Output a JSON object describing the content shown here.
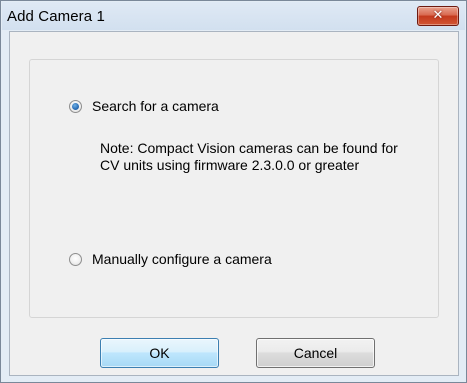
{
  "window": {
    "title": "Add Camera 1",
    "close_glyph": "✕"
  },
  "options": {
    "search": {
      "label": "Search for a camera",
      "selected": true
    },
    "note": "Note: Compact Vision cameras can be found for CV units using firmware 2.3.0.0 or greater",
    "manual": {
      "label": "Manually configure a camera",
      "selected": false
    }
  },
  "buttons": {
    "ok": "OK",
    "cancel": "Cancel"
  },
  "icons": {
    "close": "close-icon"
  }
}
